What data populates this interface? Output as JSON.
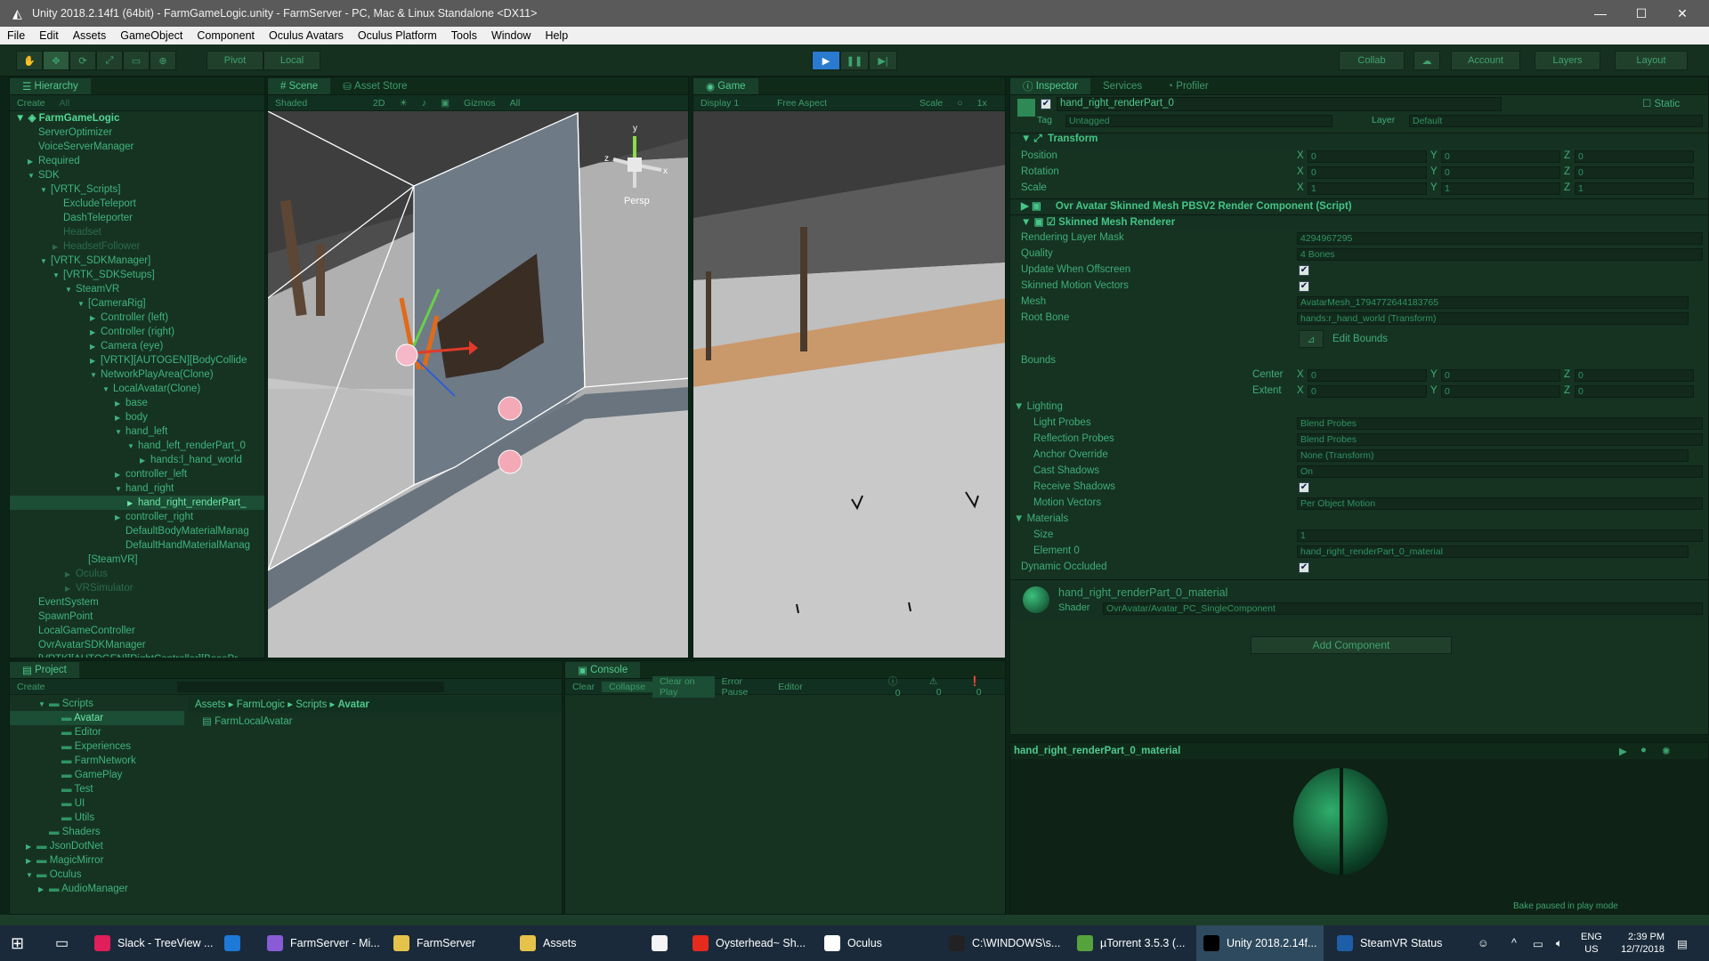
{
  "window": {
    "title": "Unity 2018.2.14f1 (64bit) - FarmGameLogic.unity - FarmServer - PC, Mac & Linux Standalone <DX11>",
    "min": "—",
    "max": "☐",
    "close": "✕"
  },
  "menu": [
    "File",
    "Edit",
    "Assets",
    "GameObject",
    "Component",
    "Oculus Avatars",
    "Oculus Platform",
    "Tools",
    "Window",
    "Help"
  ],
  "toolbar": {
    "pivot": "Pivot",
    "local": "Local",
    "collab": "Collab",
    "account": "Account",
    "layers": "Layers",
    "layout": "Layout"
  },
  "hierarchy": {
    "tab": "Hierarchy",
    "create": "Create",
    "search": "All",
    "scene": "FarmGameLogic",
    "items": [
      {
        "label": "ServerOptimizer",
        "d": 1
      },
      {
        "label": "VoiceServerManager",
        "d": 1
      },
      {
        "label": "Required",
        "d": 1,
        "a": "▶"
      },
      {
        "label": "SDK",
        "d": 1,
        "a": "▼"
      },
      {
        "label": "[VRTK_Scripts]",
        "d": 2,
        "a": "▼"
      },
      {
        "label": "ExcludeTeleport",
        "d": 3
      },
      {
        "label": "DashTeleporter",
        "d": 3
      },
      {
        "label": "Headset",
        "d": 3,
        "dim": true
      },
      {
        "label": "HeadsetFollower",
        "d": 3,
        "dim": true,
        "a": "▶"
      },
      {
        "label": "[VRTK_SDKManager]",
        "d": 2,
        "a": "▼"
      },
      {
        "label": "[VRTK_SDKSetups]",
        "d": 3,
        "a": "▼"
      },
      {
        "label": "SteamVR",
        "d": 4,
        "a": "▼"
      },
      {
        "label": "[CameraRig]",
        "d": 5,
        "a": "▼"
      },
      {
        "label": "Controller (left)",
        "d": 6,
        "a": "▶"
      },
      {
        "label": "Controller (right)",
        "d": 6,
        "a": "▶"
      },
      {
        "label": "Camera (eye)",
        "d": 6,
        "a": "▶"
      },
      {
        "label": "[VRTK][AUTOGEN][BodyCollide",
        "d": 6,
        "a": "▶"
      },
      {
        "label": "NetworkPlayArea(Clone)",
        "d": 6,
        "a": "▼"
      },
      {
        "label": "LocalAvatar(Clone)",
        "d": 7,
        "a": "▼"
      },
      {
        "label": "base",
        "d": 8,
        "a": "▶"
      },
      {
        "label": "body",
        "d": 8,
        "a": "▶"
      },
      {
        "label": "hand_left",
        "d": 8,
        "a": "▼"
      },
      {
        "label": "hand_left_renderPart_0",
        "d": 9,
        "a": "▼"
      },
      {
        "label": "hands:l_hand_world",
        "d": 10,
        "a": "▶"
      },
      {
        "label": "controller_left",
        "d": 8,
        "a": "▶"
      },
      {
        "label": "hand_right",
        "d": 8,
        "a": "▼"
      },
      {
        "label": "hand_right_renderPart_",
        "d": 9,
        "a": "▶",
        "sel": true
      },
      {
        "label": "controller_right",
        "d": 8,
        "a": "▶"
      },
      {
        "label": "DefaultBodyMaterialManag",
        "d": 8
      },
      {
        "label": "DefaultHandMaterialManag",
        "d": 8
      },
      {
        "label": "[SteamVR]",
        "d": 5
      },
      {
        "label": "Oculus",
        "d": 4,
        "dim": true,
        "a": "▶"
      },
      {
        "label": "VRSimulator",
        "d": 4,
        "dim": true,
        "a": "▶"
      },
      {
        "label": "EventSystem",
        "d": 1
      },
      {
        "label": "SpawnPoint",
        "d": 1
      },
      {
        "label": "LocalGameController",
        "d": 1
      },
      {
        "label": "OvrAvatarSDKManager",
        "d": 1
      },
      {
        "label": "[VRTK][AUTOGEN][RightController][BasePr",
        "d": 1
      }
    ]
  },
  "scene": {
    "tab": "Scene",
    "tab2": "Asset Store",
    "shaded": "Shaded",
    "mode2d": "2D",
    "gizmos": "Gizmos",
    "search": "All",
    "persp": "Persp",
    "gx": "x",
    "gy": "y",
    "gz": "z"
  },
  "game": {
    "tab": "Game",
    "display": "Display 1",
    "aspect": "Free Aspect",
    "scale": "Scale",
    "scaleval": "1x"
  },
  "inspector": {
    "tab": "Inspector",
    "tab2": "Services",
    "tab3": "Profiler",
    "object": "hand_right_renderPart_0",
    "static": "Static",
    "tag_l": "Tag",
    "tag": "Untagged",
    "layer_l": "Layer",
    "layer": "Default",
    "transform": "Transform",
    "position": "Position",
    "rotation": "Rotation",
    "scale": "Scale",
    "x": "X",
    "y": "Y",
    "z": "Z",
    "zero": "0",
    "one": "1",
    "ovr": "Ovr Avatar Skinned Mesh PBSV2 Render Component (Script)",
    "smr": "Skinned Mesh Renderer",
    "rlm_l": "Rendering Layer Mask",
    "rlm": "4294967295",
    "quality_l": "Quality",
    "quality": "4 Bones",
    "uwo": "Update When Offscreen",
    "smv": "Skinned Motion Vectors",
    "mesh_l": "Mesh",
    "mesh": "AvatarMesh_1794772644183765",
    "root_l": "Root Bone",
    "root": "hands:r_hand_world (Transform)",
    "editbounds": "Edit Bounds",
    "bounds": "Bounds",
    "center": "Center",
    "extent": "Extent",
    "lighting": "Lighting",
    "lp_l": "Light Probes",
    "lp": "Blend Probes",
    "rp_l": "Reflection Probes",
    "rp": "Blend Probes",
    "ao_l": "Anchor Override",
    "ao": "None (Transform)",
    "cs_l": "Cast Shadows",
    "cs": "On",
    "rs": "Receive Shadows",
    "mv_l": "Motion Vectors",
    "mv": "Per Object Motion",
    "materials": "Materials",
    "size_l": "Size",
    "size": "1",
    "el_l": "Element 0",
    "el": "hand_right_renderPart_0_material",
    "dyn": "Dynamic Occluded",
    "material": "hand_right_renderPart_0_material",
    "shader_l": "Shader",
    "shader": "OvrAvatar/Avatar_PC_SingleComponent",
    "addcomp": "Add Component",
    "preview": "hand_right_renderPart_0_material",
    "bake": "Bake paused in play mode"
  },
  "project": {
    "tab": "Project",
    "create": "Create",
    "crumbs": [
      "Assets",
      "FarmLogic",
      "Scripts",
      "Avatar"
    ],
    "file": "FarmLocalAvatar",
    "tree": [
      {
        "label": "Scripts",
        "d": 2,
        "a": "▼"
      },
      {
        "label": "Avatar",
        "d": 3,
        "sel": true
      },
      {
        "label": "Editor",
        "d": 3
      },
      {
        "label": "Experiences",
        "d": 3
      },
      {
        "label": "FarmNetwork",
        "d": 3
      },
      {
        "label": "GamePlay",
        "d": 3
      },
      {
        "label": "Test",
        "d": 3
      },
      {
        "label": "UI",
        "d": 3
      },
      {
        "label": "Utils",
        "d": 3
      },
      {
        "label": "Shaders",
        "d": 2
      },
      {
        "label": "JsonDotNet",
        "d": 1,
        "a": "▶"
      },
      {
        "label": "MagicMirror",
        "d": 1,
        "a": "▶"
      },
      {
        "label": "Oculus",
        "d": 1,
        "a": "▼"
      },
      {
        "label": "AudioManager",
        "d": 2,
        "a": "▶"
      }
    ]
  },
  "console": {
    "tab": "Console",
    "clear": "Clear",
    "collapse": "Collapse",
    "cop": "Clear on Play",
    "ep": "Error Pause",
    "editor": "Editor",
    "c1": "0",
    "c2": "0",
    "c3": "0"
  },
  "taskbar": {
    "items": [
      "Slack - TreeView ...",
      "",
      "FarmServer - Mi...",
      "FarmServer",
      "Assets",
      "",
      "Oysterhead~ Sh...",
      "Oculus",
      "C:\\WINDOWS\\s...",
      "µTorrent 3.5.3  (...",
      "Unity 2018.2.14f...",
      "SteamVR Status"
    ],
    "lang": "ENG",
    "region": "US",
    "time": "2:39 PM",
    "date": "12/7/2018"
  },
  "colors": {
    "accent": "#4fc98d",
    "panel": "#163322",
    "play": "#2a7ad0"
  }
}
